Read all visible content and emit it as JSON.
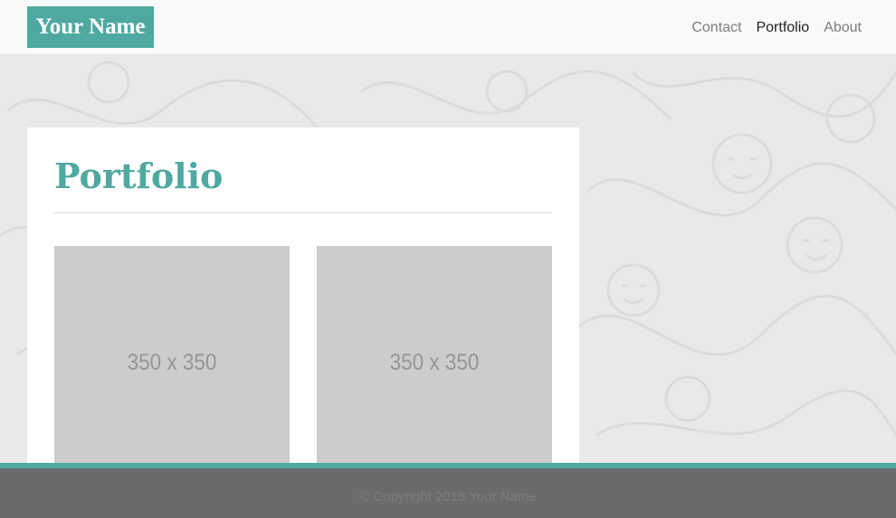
{
  "header": {
    "brand": "Your Name",
    "nav": [
      {
        "label": "Contact",
        "active": false
      },
      {
        "label": "Portfolio",
        "active": true
      },
      {
        "label": "About",
        "active": false
      }
    ]
  },
  "main": {
    "title": "Portfolio",
    "thumbnails": [
      {
        "label": "350 x 350"
      },
      {
        "label": "350 x 350"
      }
    ]
  },
  "footer": {
    "copyright": "© Copyright 2018 Your Name"
  },
  "colors": {
    "accent": "#4fa9a1",
    "navbar_bg": "#f8f9fa",
    "page_bg": "#e9e9e9",
    "footer_bg": "#6b6b6b",
    "placeholder_bg": "#cccccc"
  }
}
